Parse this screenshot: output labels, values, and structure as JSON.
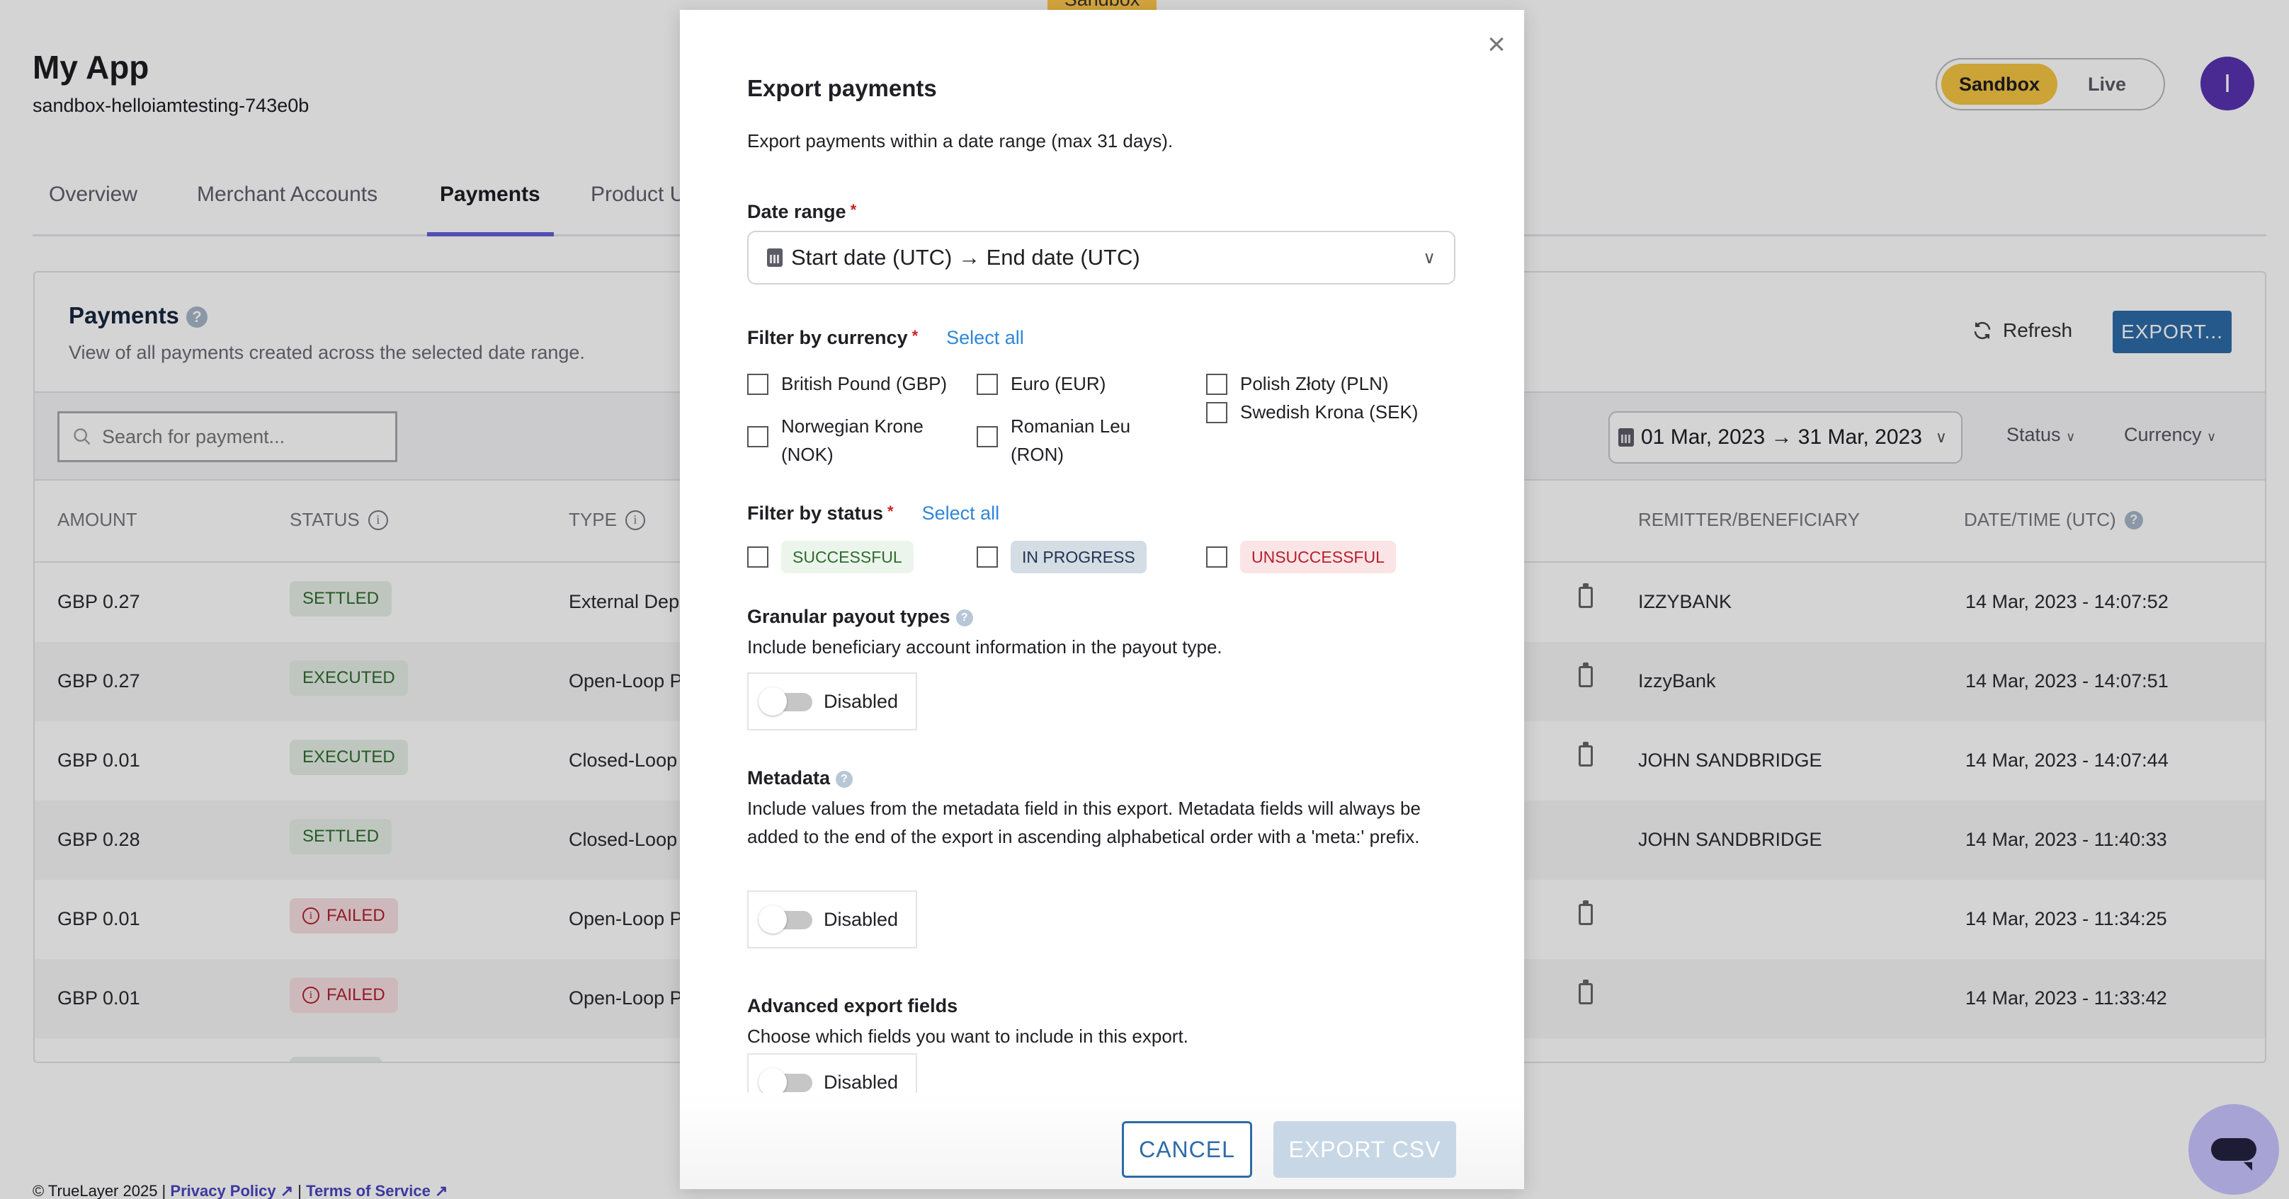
{
  "app": {
    "title": "My App",
    "subtitle": "sandbox-helloiamtesting-743e0b",
    "env_toggle": {
      "active": "Sandbox",
      "inactive": "Live"
    },
    "avatar_initial": "I",
    "sandbox_tag": "Sandbox"
  },
  "tabs": [
    {
      "label": "Overview"
    },
    {
      "label": "Merchant Accounts"
    },
    {
      "label": "Payments",
      "active": true
    },
    {
      "label": "Product U"
    }
  ],
  "payments_card": {
    "title": "Payments",
    "help_icon": "question-circle-icon",
    "subtitle": "View of all payments created across the selected date range.",
    "refresh_label": "Refresh",
    "export_label": "EXPORT...",
    "search_placeholder": "Search for payment...",
    "date_filter": "01 Mar, 2023 → 31 Mar, 2023",
    "status_dropdown": "Status",
    "currency_dropdown": "Currency",
    "columns": {
      "amount": "AMOUNT",
      "status": "STATUS",
      "type": "TYPE",
      "remitter": "REMITTER/BENEFICIARY",
      "datetime": "DATE/TIME (UTC)"
    },
    "rows": [
      {
        "amount": "GBP 0.27",
        "status": "SETTLED",
        "status_kind": "green",
        "type": "External Dep",
        "clipboard": true,
        "remitter": "IZZYBANK",
        "datetime": "14 Mar, 2023 - 14:07:52"
      },
      {
        "amount": "GBP 0.27",
        "status": "EXECUTED",
        "status_kind": "green",
        "type": "Open-Loop P",
        "clipboard": true,
        "remitter": "IzzyBank",
        "datetime": "14 Mar, 2023 - 14:07:51"
      },
      {
        "amount": "GBP 0.01",
        "status": "EXECUTED",
        "status_kind": "green",
        "type": "Closed-Loop",
        "clipboard": true,
        "remitter": "JOHN SANDBRIDGE",
        "datetime": "14 Mar, 2023 - 14:07:44"
      },
      {
        "amount": "GBP 0.28",
        "status": "SETTLED",
        "status_kind": "green",
        "type": "Closed-Loop",
        "clipboard": false,
        "remitter": "JOHN SANDBRIDGE",
        "datetime": "14 Mar, 2023 - 11:40:33"
      },
      {
        "amount": "GBP 0.01",
        "status": "FAILED",
        "status_kind": "red",
        "type": "Open-Loop P",
        "clipboard": true,
        "remitter": "",
        "datetime": "14 Mar, 2023 - 11:34:25"
      },
      {
        "amount": "GBP 0.01",
        "status": "FAILED",
        "status_kind": "red",
        "type": "Open-Loop P",
        "clipboard": true,
        "remitter": "",
        "datetime": "14 Mar, 2023 - 11:33:42"
      }
    ]
  },
  "footer": {
    "copyright": "© TrueLayer 2025 |",
    "privacy": "Privacy Policy",
    "separator": "|",
    "terms": "Terms of Service"
  },
  "modal": {
    "title": "Export payments",
    "description": "Export payments within a date range (max 31 days).",
    "date_range_label": "Date range",
    "required_mark": "*",
    "date_range_placeholder": "Start date (UTC) → End date (UTC)",
    "currency_label": "Filter by currency",
    "select_all": "Select all",
    "currencies": [
      {
        "label": "British Pound (GBP)",
        "checked": false
      },
      {
        "label": "Euro (EUR)",
        "checked": false
      },
      {
        "label": "Polish Złoty (PLN)",
        "checked": false
      },
      {
        "label": "Norwegian Krone (NOK)",
        "checked": false
      },
      {
        "label": "Romanian Leu (RON)",
        "checked": false
      },
      {
        "label": "Swedish Krona (SEK)",
        "checked": false
      }
    ],
    "status_label": "Filter by status",
    "statuses": [
      {
        "label": "SUCCESSFUL",
        "checked": false
      },
      {
        "label": "IN PROGRESS",
        "checked": false
      },
      {
        "label": "UNSUCCESSFUL",
        "checked": false
      }
    ],
    "granular": {
      "label": "Granular payout types",
      "description": "Include beneficiary account information in the payout type.",
      "toggle": "Disabled"
    },
    "metadata": {
      "label": "Metadata",
      "description": "Include values from the metadata field in this export. Metadata fields will always be added to the end of the export in ascending alphabetical order with a 'meta:' prefix.",
      "toggle": "Disabled"
    },
    "advanced": {
      "label": "Advanced export fields",
      "description": "Choose which fields you want to include in this export.",
      "toggle": "Disabled"
    },
    "cancel_label": "CANCEL",
    "export_label": "EXPORT CSV",
    "colors": {
      "primary": "#2e6ba8",
      "disabled": "#c7d7e6",
      "link": "#2f86d6"
    }
  }
}
